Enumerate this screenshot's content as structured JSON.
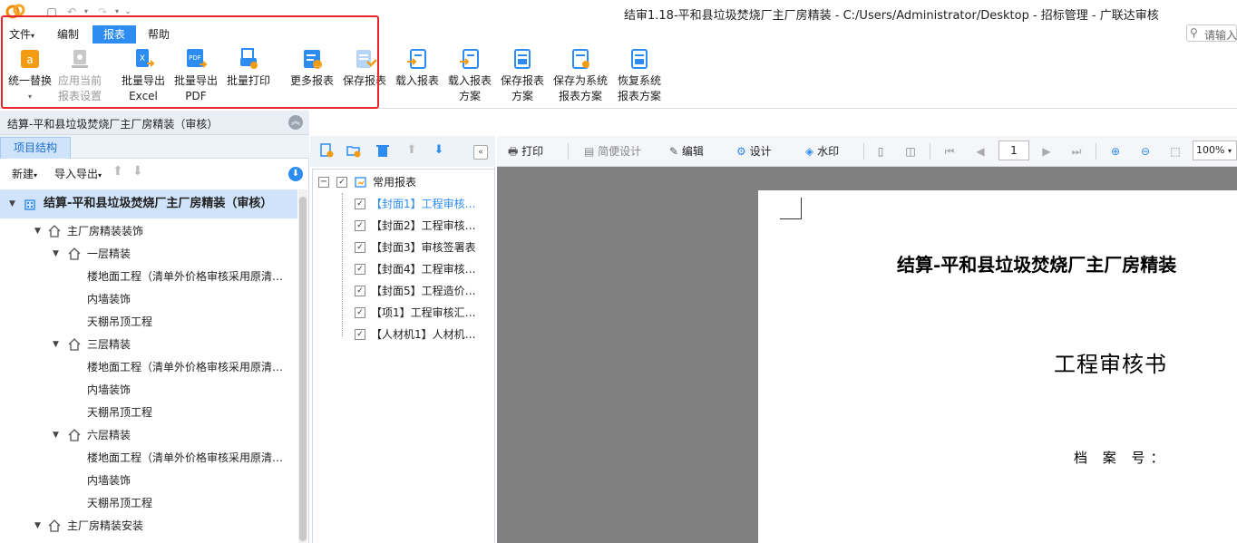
{
  "window": {
    "title": "结审1.18-平和县垃圾焚烧厂主厂房精装 - C:/Users/Administrator/Desktop - 招标管理 - 广联达审核"
  },
  "menu": {
    "tabs": [
      "文件",
      "编制",
      "报表",
      "帮助"
    ],
    "active_tab": "报表",
    "search_placeholder": "请输入"
  },
  "ribbon": {
    "buttons": [
      {
        "label1": "统一替换",
        "label2": "",
        "icon": "replace-icon",
        "enabled": true
      },
      {
        "label1": "应用当前",
        "label2": "报表设置",
        "icon": "apply-settings-icon",
        "enabled": false
      },
      {
        "label1": "批量导出",
        "label2": "Excel",
        "icon": "excel-export-icon",
        "enabled": true
      },
      {
        "label1": "批量导出",
        "label2": "PDF",
        "icon": "pdf-export-icon",
        "enabled": true
      },
      {
        "label1": "批量打印",
        "label2": "",
        "icon": "print-batch-icon",
        "enabled": true
      },
      {
        "label1": "更多报表",
        "label2": "",
        "icon": "more-reports-icon",
        "enabled": true
      },
      {
        "label1": "保存报表",
        "label2": "",
        "icon": "save-report-icon",
        "enabled": true
      },
      {
        "label1": "载入报表",
        "label2": "",
        "icon": "load-report-icon",
        "enabled": true
      },
      {
        "label1": "载入报表",
        "label2": "方案",
        "icon": "load-scheme-icon",
        "enabled": true
      },
      {
        "label1": "保存报表",
        "label2": "方案",
        "icon": "save-scheme-icon",
        "enabled": true
      },
      {
        "label1": "保存为系统",
        "label2": "报表方案",
        "icon": "save-system-scheme-icon",
        "enabled": true
      },
      {
        "label1": "恢复系统",
        "label2": "报表方案",
        "icon": "restore-scheme-icon",
        "enabled": true
      }
    ]
  },
  "left_panel": {
    "header": "结算-平和县垃圾焚烧厂主厂房精装（审核）",
    "tab": "项目结构",
    "toolbar": {
      "new_label": "新建",
      "import_export_label": "导入导出"
    },
    "tree": [
      {
        "label": "结算-平和县垃圾焚烧厂主厂房精装（审核）",
        "level": 0
      },
      {
        "label": "主厂房精装装饰",
        "level": 1
      },
      {
        "label": "一层精装",
        "level": 2
      },
      {
        "label": "楼地面工程（清单外价格审核采用原清…",
        "level": 3
      },
      {
        "label": "内墙装饰",
        "level": 3
      },
      {
        "label": "天棚吊顶工程",
        "level": 3
      },
      {
        "label": "三层精装",
        "level": 2
      },
      {
        "label": "楼地面工程（清单外价格审核采用原清…",
        "level": 3
      },
      {
        "label": "内墙装饰",
        "level": 3
      },
      {
        "label": "天棚吊顶工程",
        "level": 3
      },
      {
        "label": "六层精装",
        "level": 2
      },
      {
        "label": "楼地面工程（清单外价格审核采用原清…",
        "level": 3
      },
      {
        "label": "内墙装饰",
        "level": 3
      },
      {
        "label": "天棚吊顶工程",
        "level": 3
      },
      {
        "label": "主厂房精装安装",
        "level": 1
      }
    ]
  },
  "report_list": {
    "group": "常用报表",
    "items": [
      "【封面1】工程审核…",
      "【封面2】工程审核…",
      "【封面3】审核签署表",
      "【封面4】工程审核…",
      "【封面5】工程造价…",
      "【项1】工程审核汇…",
      "【人材机1】人材机…"
    ],
    "selected_index": 0
  },
  "preview_toolbar": {
    "print": "打印",
    "simple_design": "简便设计",
    "edit": "编辑",
    "design": "设计",
    "watermark": "水印",
    "page": "1",
    "zoom": "100%"
  },
  "document": {
    "title": "结算-平和县垃圾焚烧厂主厂房精装",
    "heading": "工程审核书",
    "archive_label": "档 案 号："
  },
  "colors": {
    "accent": "#2d8cf0",
    "highlight_border": "#e8252a",
    "selected_row": "#cfe4fa",
    "preview_bg": "#808080"
  }
}
